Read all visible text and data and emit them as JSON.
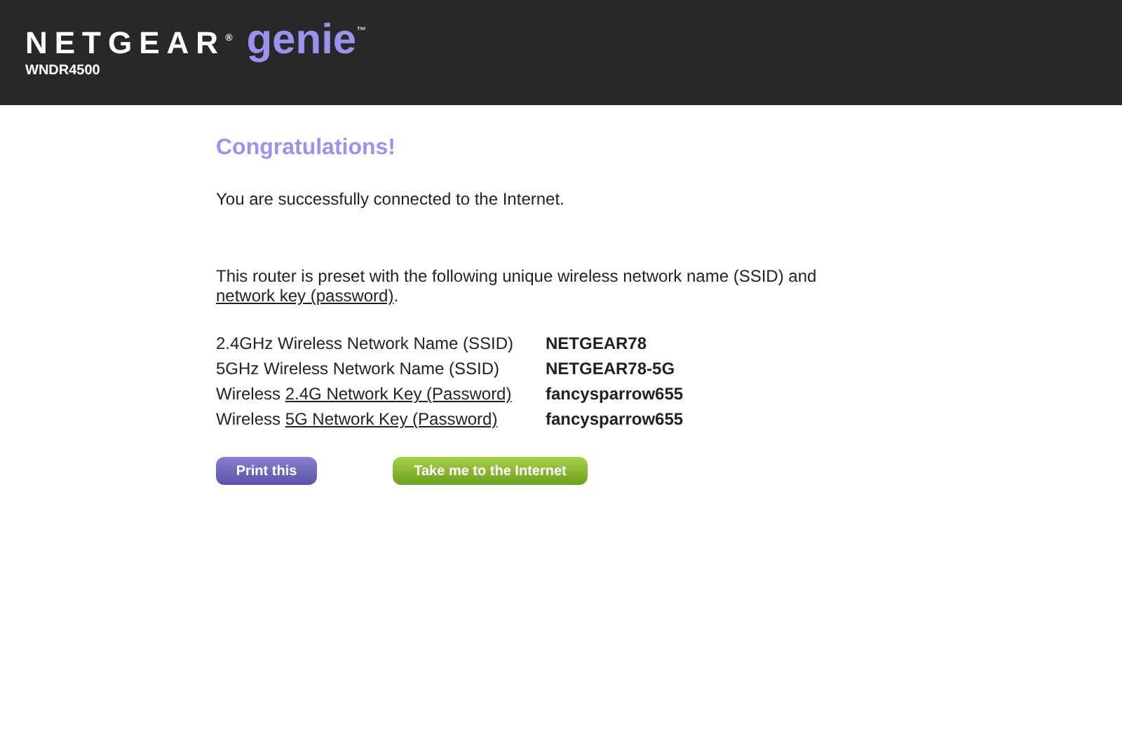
{
  "header": {
    "brand": "NETGEAR",
    "brand_mark": "®",
    "product": "genie",
    "product_mark": "™",
    "model": "WNDR4500"
  },
  "title": "Congratulations!",
  "status": "You are successfully connected to the Internet.",
  "intro": {
    "text": "This router is preset with the following unique wireless network name (SSID) and ",
    "link": "network key (password)",
    "end": "."
  },
  "rows": [
    {
      "label": "2.4GHz Wireless Network Name (SSID)",
      "value": "NETGEAR78"
    },
    {
      "label": "5GHz Wireless Network Name (SSID)",
      "value": "NETGEAR78-5G"
    },
    {
      "label": "Wireless ",
      "link": "2.4G Network Key (Password)",
      "value": "fancysparrow655"
    },
    {
      "label": "Wireless ",
      "link": "5G Network Key (Password)",
      "value": "fancysparrow655"
    }
  ],
  "buttons": [
    {
      "label": "Print this",
      "kind": "secondary"
    },
    {
      "label": "Take me to the Internet",
      "kind": "primary"
    }
  ]
}
